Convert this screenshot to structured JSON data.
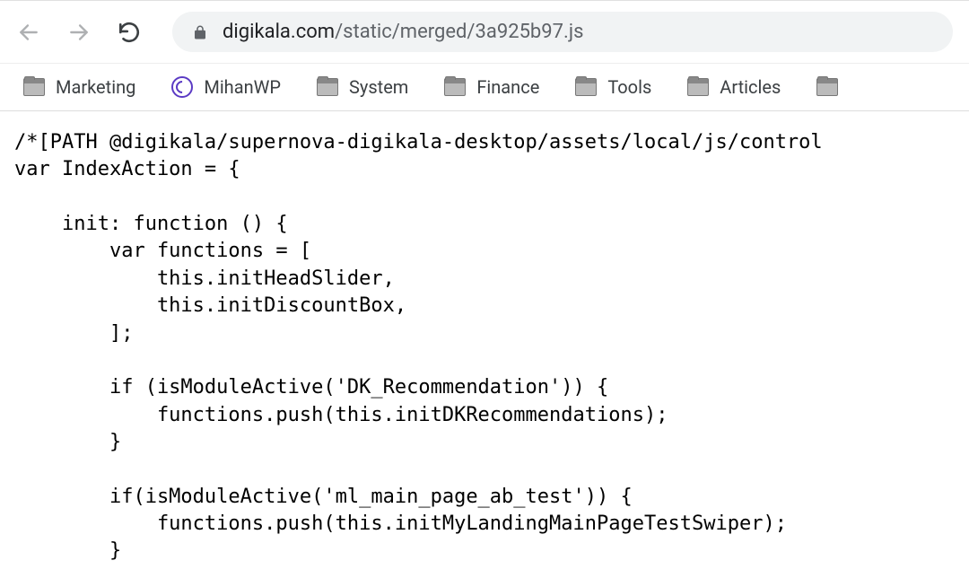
{
  "toolbar": {
    "url_domain": "digikala.com",
    "url_path": "/static/merged/3a925b97.js"
  },
  "bookmarks": [
    {
      "label": "Marketing",
      "icon": "folder"
    },
    {
      "label": "MihanWP",
      "icon": "mihan"
    },
    {
      "label": "System",
      "icon": "folder"
    },
    {
      "label": "Finance",
      "icon": "folder"
    },
    {
      "label": "Tools",
      "icon": "folder"
    },
    {
      "label": "Articles",
      "icon": "folder"
    }
  ],
  "code": "/*[PATH @digikala/supernova-digikala-desktop/assets/local/js/control\nvar IndexAction = {\n\n    init: function () {\n        var functions = [\n            this.initHeadSlider,\n            this.initDiscountBox,\n        ];\n\n        if (isModuleActive('DK_Recommendation')) {\n            functions.push(this.initDKRecommendations);\n        }\n\n        if(isModuleActive('ml_main_page_ab_test')) {\n            functions.push(this.initMyLandingMainPageTestSwiper);\n        }"
}
